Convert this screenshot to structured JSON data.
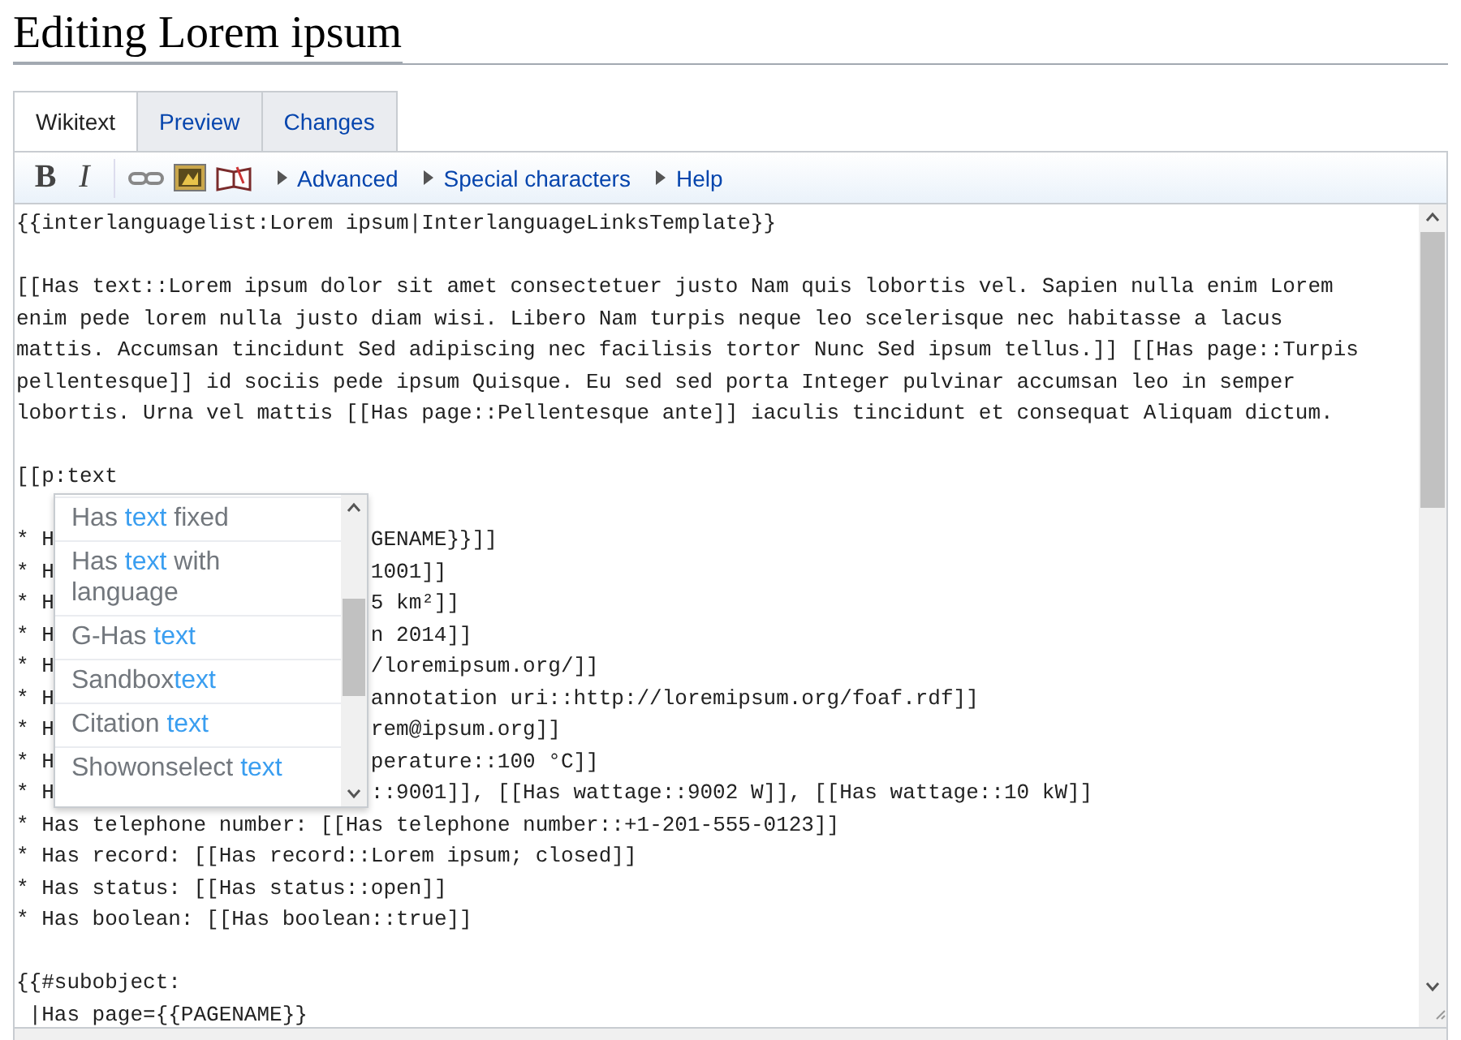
{
  "page_title": "Editing Lorem ipsum",
  "tabs": [
    {
      "label": "Wikitext",
      "selected": true
    },
    {
      "label": "Preview",
      "selected": false
    },
    {
      "label": "Changes",
      "selected": false
    }
  ],
  "toolbar": {
    "bold": "B",
    "italic": "I",
    "groups": [
      "Advanced",
      "Special characters",
      "Help"
    ]
  },
  "editor_lines": [
    {
      "kind": "text",
      "text": "{{interlanguagelist:Lorem ipsum|InterlanguageLinksTemplate}}"
    },
    {
      "kind": "blank"
    },
    {
      "kind": "text",
      "text": "[[Has text::Lorem ipsum dolor sit amet consectetuer justo Nam quis lobortis vel. Sapien nulla enim Lorem"
    },
    {
      "kind": "text",
      "text": "enim pede lorem nulla justo diam wisi. Libero Nam turpis neque leo scelerisque nec habitasse a lacus"
    },
    {
      "kind": "text",
      "text": "mattis. Accumsan tincidunt Sed adipiscing nec facilisis tortor Nunc Sed ipsum tellus.]] [[Has page::Turpis"
    },
    {
      "kind": "text",
      "text": "pellentesque]] id sociis pede ipsum Quisque. Eu sed sed porta Integer pulvinar accumsan leo in semper"
    },
    {
      "kind": "text",
      "text": "lobortis. Urna vel mattis [[Has page::Pellentesque ante]] iaculis tincidunt et consequat Aliquam dictum."
    },
    {
      "kind": "blank"
    },
    {
      "kind": "text",
      "text": "[[p:text"
    },
    {
      "kind": "blank"
    },
    {
      "kind": "split",
      "left": "* H",
      "right": "GENAME}}]]"
    },
    {
      "kind": "split",
      "left": "* H",
      "right": "1001]]"
    },
    {
      "kind": "split",
      "left": "* H",
      "right": "5 km²]]"
    },
    {
      "kind": "split",
      "left": "* H",
      "right": "n 2014]]"
    },
    {
      "kind": "split",
      "left": "* H",
      "right": "/loremipsum.org/]]"
    },
    {
      "kind": "split",
      "left": "* H",
      "right": "annotation uri::http://loremipsum.org/foaf.rdf]]"
    },
    {
      "kind": "split",
      "left": "* H",
      "right": "rem@ipsum.org]]"
    },
    {
      "kind": "split",
      "left": "* H",
      "right": "perature::100 °C]]"
    },
    {
      "kind": "split",
      "left": "* H",
      "right": "::9001]], [[Has wattage::9002 W]], [[Has wattage::10 kW]]"
    },
    {
      "kind": "text",
      "text": "* Has telephone number: [[Has telephone number::+1-201-555-0123]]"
    },
    {
      "kind": "text",
      "text": "* Has record: [[Has record::Lorem ipsum; closed]]"
    },
    {
      "kind": "text",
      "text": "* Has status: [[Has status::open]]"
    },
    {
      "kind": "text",
      "text": "* Has boolean: [[Has boolean::true]]"
    },
    {
      "kind": "blank"
    },
    {
      "kind": "text",
      "text": "{{#subobject:"
    },
    {
      "kind": "text",
      "text": " |Has page={{PAGENAME}}"
    }
  ],
  "suggestions": [
    {
      "parts": [
        {
          "text": "Has ",
          "match": false
        },
        {
          "text": "text",
          "match": true
        },
        {
          "text": " fixed",
          "match": false
        }
      ]
    },
    {
      "parts": [
        {
          "text": "Has ",
          "match": false
        },
        {
          "text": "text",
          "match": true
        },
        {
          "text": " with language",
          "match": false
        }
      ]
    },
    {
      "parts": [
        {
          "text": "G-Has ",
          "match": false
        },
        {
          "text": "text",
          "match": true
        }
      ]
    },
    {
      "parts": [
        {
          "text": "Sandbox",
          "match": false
        },
        {
          "text": "text",
          "match": true
        }
      ]
    },
    {
      "parts": [
        {
          "text": "Citation ",
          "match": false
        },
        {
          "text": "text",
          "match": true
        }
      ]
    },
    {
      "parts": [
        {
          "text": "Showonselect ",
          "match": false
        },
        {
          "text": "text",
          "match": true
        }
      ]
    }
  ]
}
